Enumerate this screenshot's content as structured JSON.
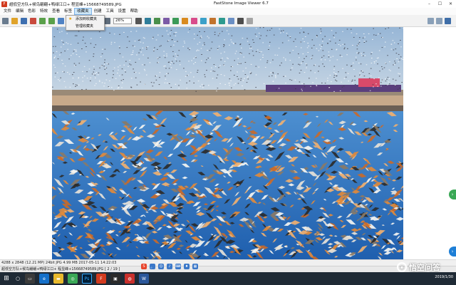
{
  "window": {
    "title": "超低空方队+候鸟翩翩+鸭绿江口+ 程显峰+15668749589.JPG",
    "app_title": "FastStone Image Viewer 6.7"
  },
  "menu": {
    "items": [
      "文件",
      "编辑",
      "色彩",
      "特效",
      "查看",
      "标签",
      "收藏夹",
      "创建",
      "工具",
      "设置",
      "帮助"
    ],
    "active_index": 6
  },
  "favorites_menu": {
    "items": [
      "添加到收藏夹",
      "管理收藏夹"
    ]
  },
  "toolbar": {
    "zoom_value": "26%"
  },
  "status": {
    "info": "4288 x 2848 (12.21 MP)  24bit  JPG  4.99 MB    2017-05-11 14:22:03",
    "file": "超低空方队+候鸟翩翩+鸭绿江口+ 程显峰+15668749589.JPG [ 2 / 19 ]"
  },
  "taskbar": {
    "date": "2019/1/30"
  },
  "watermark": {
    "text": "悟空问答"
  },
  "colors": {
    "sky": "#a9c3dc",
    "water": "#2f6fb8",
    "accent": "#0078d7"
  }
}
